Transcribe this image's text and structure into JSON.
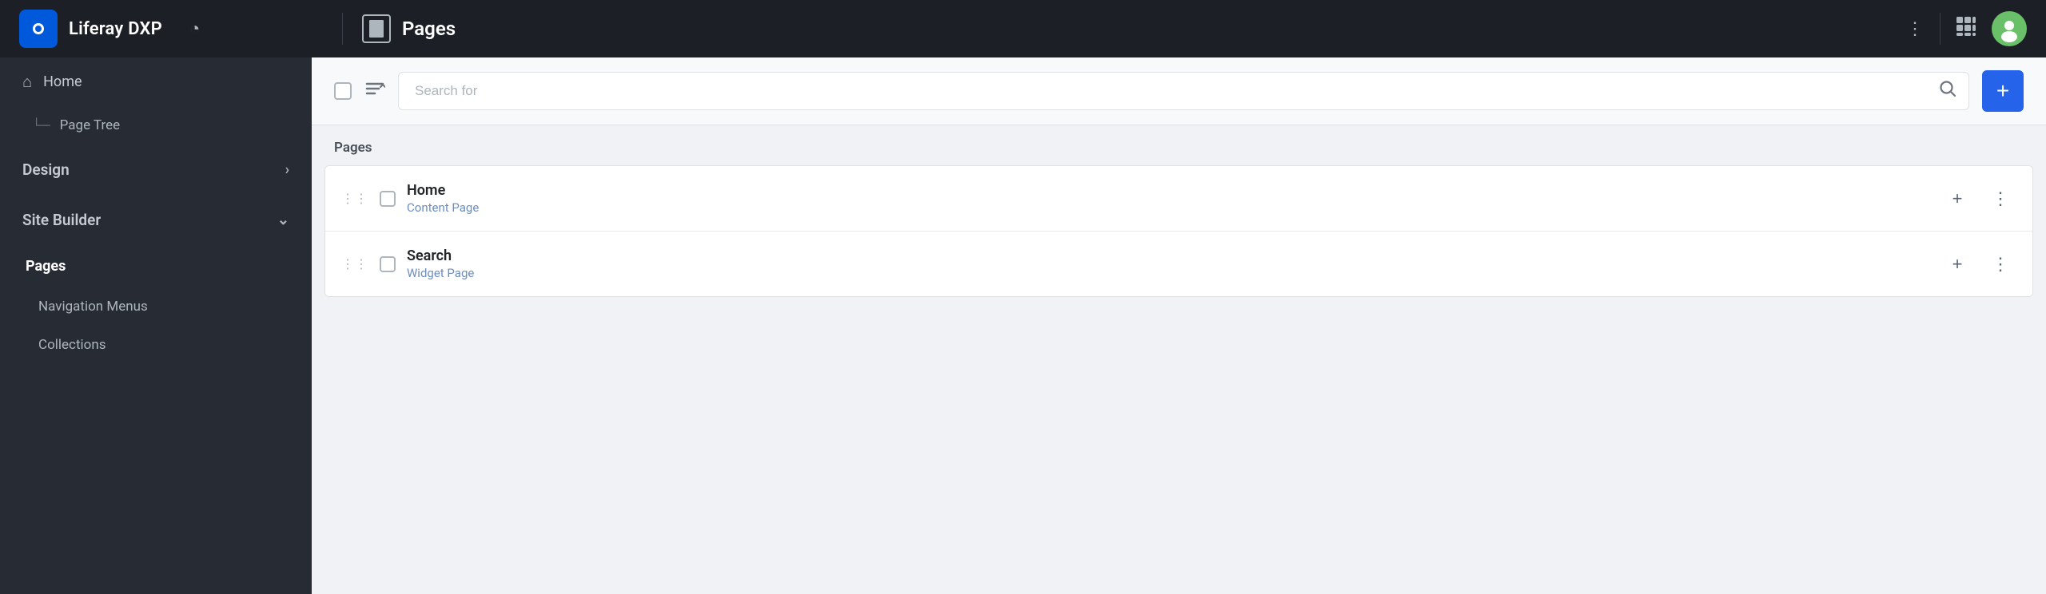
{
  "topbar": {
    "brand_name": "Liferay DXP",
    "page_title": "Pages",
    "dots_icon": "⋮",
    "grid_icon": "⠿"
  },
  "sidebar": {
    "home_label": "Home",
    "page_tree_label": "Page Tree",
    "design_label": "Design",
    "site_builder_label": "Site Builder",
    "pages_label": "Pages",
    "navigation_menus_label": "Navigation Menus",
    "collections_label": "Collections"
  },
  "toolbar": {
    "search_placeholder": "Search for",
    "add_icon": "+"
  },
  "content": {
    "section_label": "Pages",
    "rows": [
      {
        "name": "Home",
        "type": "Content Page"
      },
      {
        "name": "Search",
        "type": "Widget Page"
      }
    ]
  }
}
